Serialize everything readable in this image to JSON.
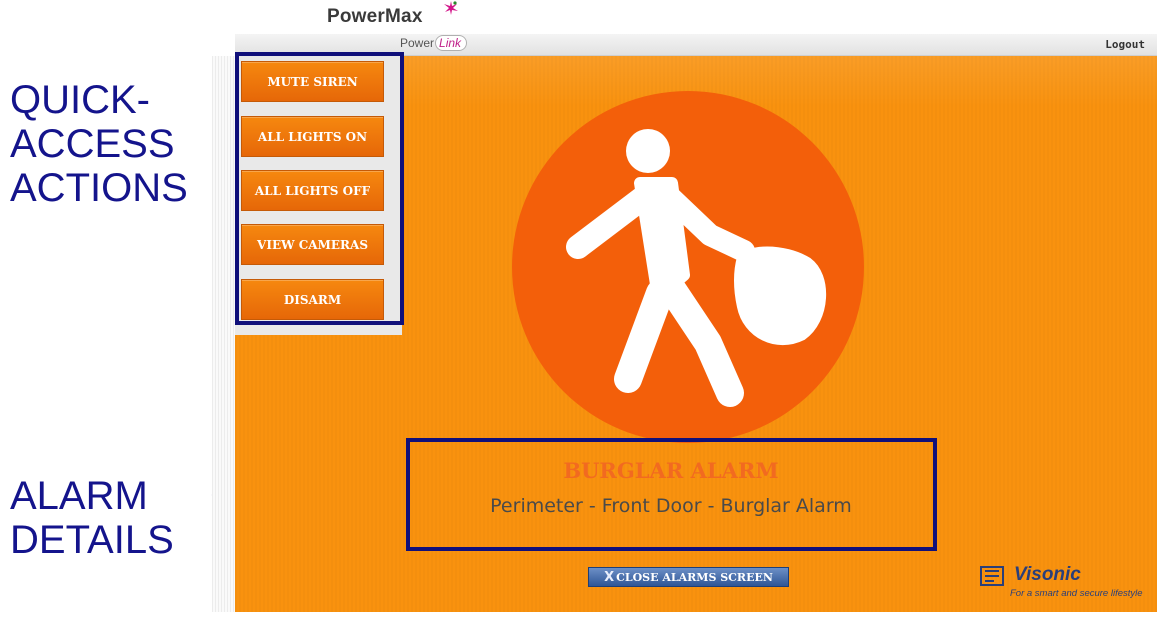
{
  "annotations": {
    "quick_access": "QUICK-\nACCESS\nACTIONS",
    "alarm_details": "ALARM\nDETAILS"
  },
  "app": {
    "brand": "PowerMax",
    "sub_brand_prefix": "Power",
    "sub_brand_suffix": "Link",
    "logout_label": "Logout"
  },
  "quick_actions": [
    {
      "label": "MUTE SIREN"
    },
    {
      "label": "ALL LIGHTS ON"
    },
    {
      "label": "ALL LIGHTS OFF"
    },
    {
      "label": "VIEW CAMERAS"
    },
    {
      "label": "DISARM"
    }
  ],
  "alarm": {
    "icon": "burglar-icon",
    "title": "BURGLAR ALARM",
    "description": "Perimeter - Front Door - Burglar Alarm"
  },
  "close_button": {
    "icon": "X",
    "label": "CLOSE ALARMS SCREEN"
  },
  "footer_logo": {
    "name": "Visonic",
    "tagline": "For a smart and secure lifestyle"
  },
  "colors": {
    "stage_orange": "#f9920e",
    "alarm_circle": "#f35f0a",
    "button_orange": "#e66708",
    "annotation_blue": "#14148c"
  }
}
